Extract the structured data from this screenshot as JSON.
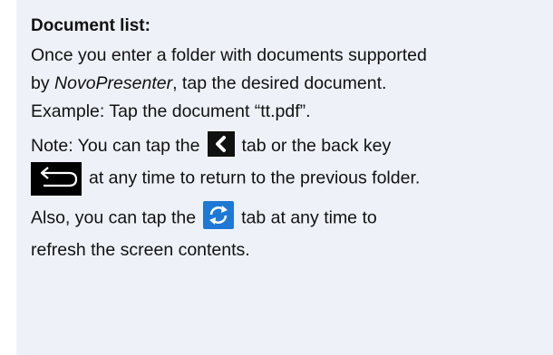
{
  "section": {
    "heading": "Document list:",
    "intro_line1": "Once you enter a folder with documents supported",
    "intro_line2_prefix": "by ",
    "app_name": "NovoPresenter",
    "intro_line2_suffix": ", tap the desired document.",
    "example": "Example: Tap the document “tt.pdf”.",
    "note_part1": "Note: You can tap the",
    "note_part2": "tab or the back key",
    "note_part3": "at any time to return to the previous folder.",
    "also_part1": "Also, you can tap the",
    "also_part2": "tab at any time to",
    "also_line2": "refresh the screen contents."
  },
  "icons": {
    "back_tab": "chevron-left-icon",
    "back_key": "back-arrow-icon",
    "refresh": "refresh-icon"
  },
  "colors": {
    "panel_background": "#eef2f8",
    "refresh_icon_background": "#1f78d6"
  }
}
